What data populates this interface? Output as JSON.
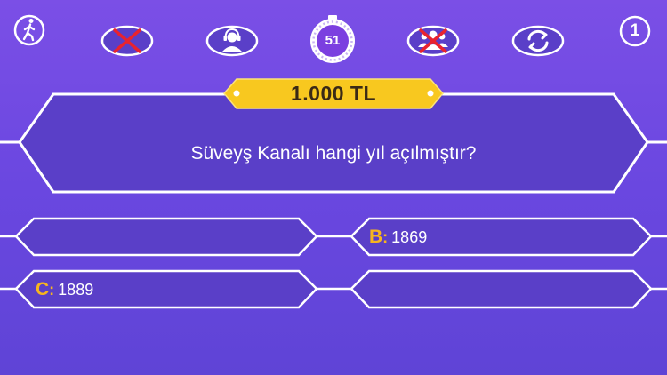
{
  "hud": {
    "walk_away": {
      "icon": "walking-person-icon"
    },
    "lifeline_fifty_fifty": {
      "icon": "red-x-icon",
      "used": true
    },
    "lifeline_phone": {
      "icon": "headset-person-icon",
      "used": false
    },
    "timer": {
      "value": "51",
      "icon": "stopwatch-icon"
    },
    "lifeline_audience": {
      "icon": "audience-people-icon",
      "used": true
    },
    "lifeline_switch": {
      "icon": "refresh-arrows-icon",
      "used": false
    },
    "level": "1"
  },
  "prize": "1.000 TL",
  "question": "Süveyş Kanalı hangi yıl açılmıştır?",
  "answers": [
    {
      "letter": "",
      "text": ""
    },
    {
      "letter": "B",
      "text": "1869"
    },
    {
      "letter": "C",
      "text": "1889"
    },
    {
      "letter": "",
      "text": ""
    }
  ],
  "colors": {
    "background": "#6a47e0",
    "panel": "#5a3fc8",
    "outline": "#ffffff",
    "gold": "#f7c623",
    "letter": "#f7b51e",
    "used_x": "#e8232f"
  }
}
